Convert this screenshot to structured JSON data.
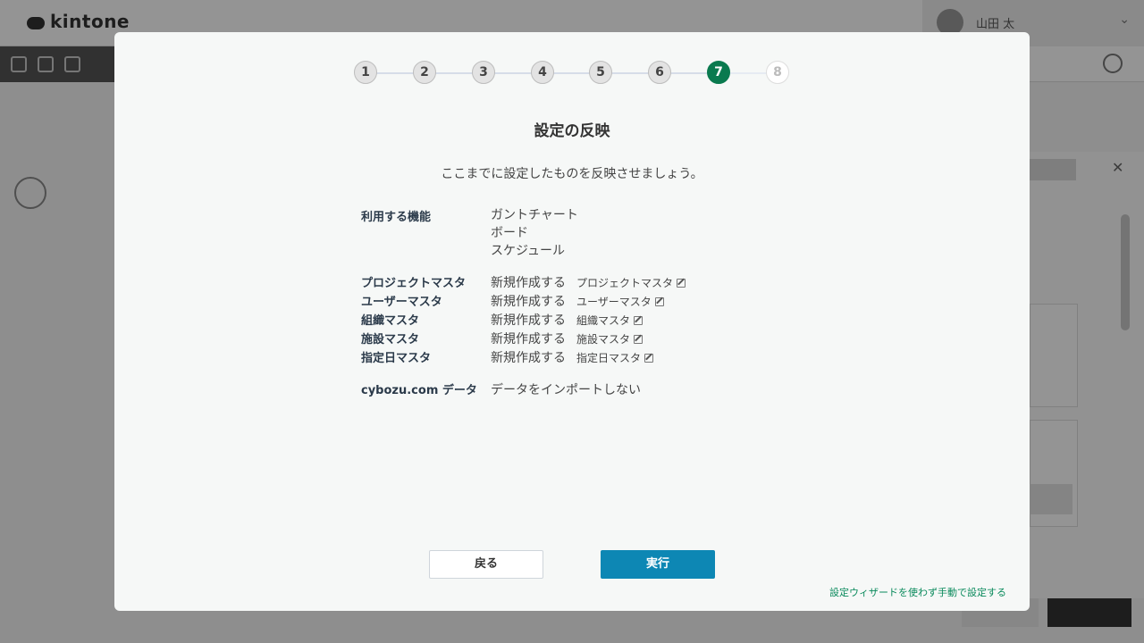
{
  "background": {
    "logo_text": "kintone",
    "user_name": "山田 太"
  },
  "wizard": {
    "steps": [
      {
        "label": "1",
        "state": "done"
      },
      {
        "label": "2",
        "state": "done"
      },
      {
        "label": "3",
        "state": "done"
      },
      {
        "label": "4",
        "state": "done"
      },
      {
        "label": "5",
        "state": "done"
      },
      {
        "label": "6",
        "state": "done"
      },
      {
        "label": "7",
        "state": "current"
      },
      {
        "label": "8",
        "state": "todo"
      }
    ],
    "current_step": 7,
    "title": "設定の反映",
    "subtitle": "ここまでに設定したものを反映させましょう。",
    "features": {
      "label": "利用する機能",
      "items": [
        "ガントチャート",
        "ボード",
        "スケジュール"
      ]
    },
    "masters": [
      {
        "label": "プロジェクトマスタ",
        "action": "新規作成する",
        "name": "プロジェクトマスタ"
      },
      {
        "label": "ユーザーマスタ",
        "action": "新規作成する",
        "name": "ユーザーマスタ"
      },
      {
        "label": "組織マスタ",
        "action": "新規作成する",
        "name": "組織マスタ"
      },
      {
        "label": "施設マスタ",
        "action": "新規作成する",
        "name": "施設マスタ"
      },
      {
        "label": "指定日マスタ",
        "action": "新規作成する",
        "name": "指定日マスタ"
      }
    ],
    "cybozu": {
      "label": "cybozu.com データ",
      "value": "データをインポートしない"
    },
    "buttons": {
      "back": "戻る",
      "run": "実行"
    },
    "manual_link": "設定ウィザードを使わず手動で設定する"
  },
  "colors": {
    "current_step": "#0a7a4f",
    "run_button": "#0d87b4",
    "link": "#0a8a5c"
  }
}
